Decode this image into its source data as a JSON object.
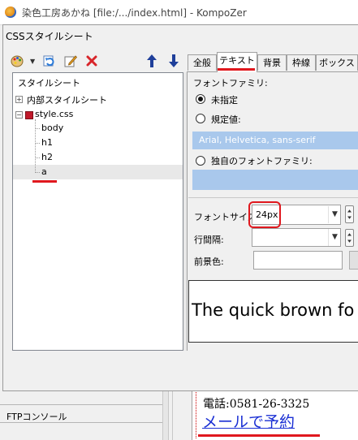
{
  "window": {
    "title": "染色工房あかね [file:/.../index.html] - KompoZer"
  },
  "dialog": {
    "title": "CSSスタイルシート",
    "toolbar": {
      "icons": [
        "palette-icon",
        "dropdown-arrow-icon",
        "refresh-icon",
        "edit-icon",
        "delete-icon",
        "move-up-icon",
        "move-down-icon"
      ]
    },
    "tree": {
      "header": "スタイルシート",
      "items": [
        {
          "label": "内部スタイルシート",
          "expander": "+"
        },
        {
          "label": "style.css",
          "expander": "−"
        },
        {
          "label": "body"
        },
        {
          "label": "h1"
        },
        {
          "label": "h2"
        },
        {
          "label": "a",
          "selected": true
        }
      ]
    },
    "tabs": [
      {
        "label": "全般"
      },
      {
        "label": "テキスト",
        "active": true
      },
      {
        "label": "背景"
      },
      {
        "label": "枠線"
      },
      {
        "label": "ボックス"
      }
    ],
    "text_panel": {
      "font_family_label": "フォントファミリ:",
      "option_unspecified": "未指定",
      "option_predefined": "規定値:",
      "predefined_font": "Arial, Helvetica, sans-serif",
      "option_custom": "独自のフォントファミリ:",
      "selected_option": "未指定",
      "font_size_label": "フォントサイズ:",
      "font_size_value": "24px",
      "line_height_label": "行間隔:",
      "line_height_value": "",
      "foreground_color_label": "前景色:",
      "foreground_color_value": "",
      "preview_text": "The quick brown fo"
    }
  },
  "background": {
    "ftp_console_label": "FTPコンソール",
    "editor": {
      "phone_line": "電話:0581-26-3325",
      "mail_link": "メールで予約"
    }
  },
  "colors": {
    "annotation_red": "#e0181e",
    "selection_blue": "#a9c8ec",
    "link_blue": "#1a2fd4"
  }
}
